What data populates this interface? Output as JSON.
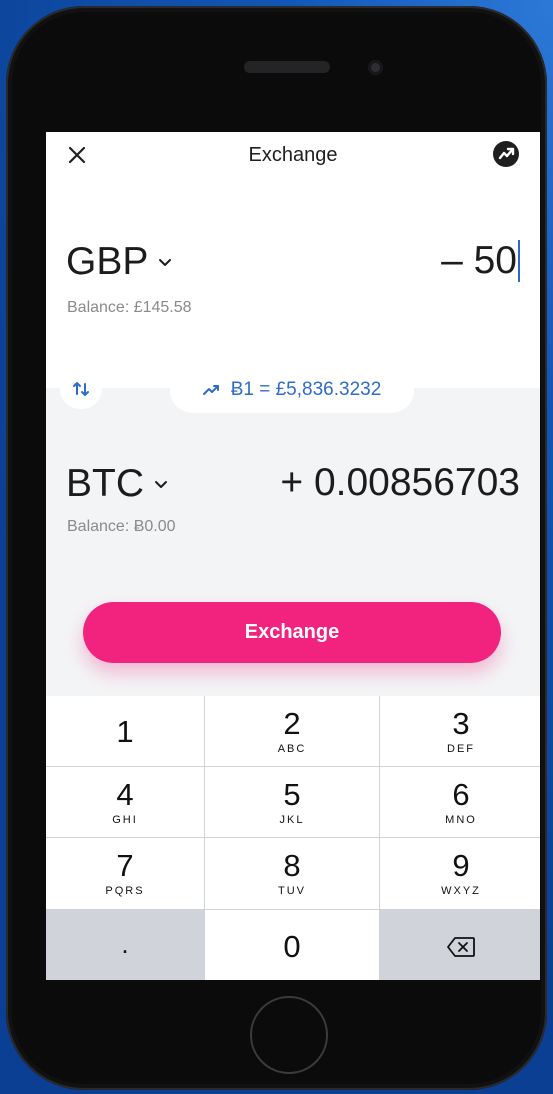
{
  "header": {
    "title": "Exchange"
  },
  "from": {
    "currency": "GBP",
    "amount": "– 50",
    "balance": "Balance: £145.58"
  },
  "rate": {
    "text": "Ƀ1 = £5,836.3232"
  },
  "to": {
    "currency": "BTC",
    "amount": "+ 0.00856703",
    "balance": "Balance: Ƀ0.00"
  },
  "actions": {
    "exchange_label": "Exchange"
  },
  "keypad": {
    "keys": [
      {
        "digit": "1",
        "letters": ""
      },
      {
        "digit": "2",
        "letters": "ABC"
      },
      {
        "digit": "3",
        "letters": "DEF"
      },
      {
        "digit": "4",
        "letters": "GHI"
      },
      {
        "digit": "5",
        "letters": "JKL"
      },
      {
        "digit": "6",
        "letters": "MNO"
      },
      {
        "digit": "7",
        "letters": "PQRS"
      },
      {
        "digit": "8",
        "letters": "TUV"
      },
      {
        "digit": "9",
        "letters": "WXYZ"
      },
      {
        "digit": ".",
        "letters": ""
      },
      {
        "digit": "0",
        "letters": ""
      }
    ]
  },
  "colors": {
    "accent": "#f2227f",
    "link": "#2f6cc9"
  }
}
